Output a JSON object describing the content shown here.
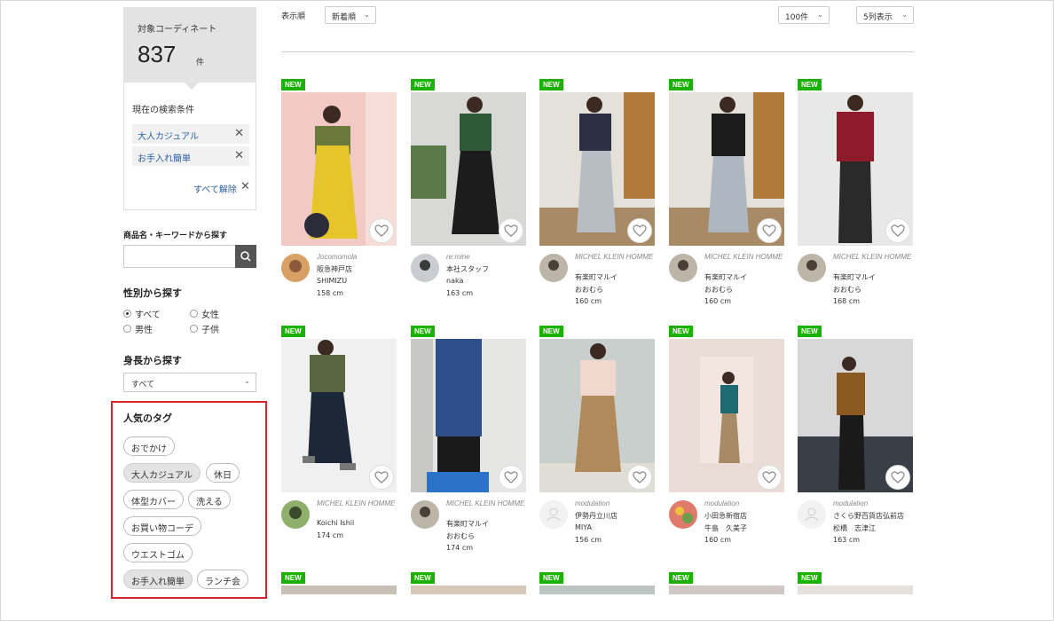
{
  "summary": {
    "label": "対象コーディネート",
    "count": "837",
    "unit": "件"
  },
  "conditions": {
    "title": "現在の検索条件",
    "items": [
      "大人カジュアル",
      "お手入れ簡単"
    ],
    "clear_all": "すべて解除"
  },
  "keyword": {
    "title": "商品名・キーワードから探す",
    "placeholder": ""
  },
  "gender": {
    "title": "性別から探す",
    "options": [
      "すべて",
      "女性",
      "男性",
      "子供"
    ],
    "selected": "すべて"
  },
  "height": {
    "title": "身長から探す",
    "value": "すべて"
  },
  "tags": {
    "title": "人気のタグ",
    "items": [
      "おでかけ",
      "大人カジュアル",
      "休日",
      "体型カバー",
      "洗える",
      "お買い物コーデ",
      "ウエストゴム",
      "お手入れ簡単",
      "ランチ会"
    ],
    "selected": [
      "大人カジュアル",
      "お手入れ簡単"
    ]
  },
  "toolbar": {
    "sort_label": "表示順",
    "sort_value": "新着順",
    "per_page": "100件",
    "columns": "5列表示"
  },
  "badge_text": "NEW",
  "cards": [
    {
      "brand": "Jocomomola",
      "store": "阪急神戸店",
      "staff": "SHIMIZU",
      "height": "158 cm"
    },
    {
      "brand": "re:mine",
      "store": "本社スタッフ",
      "staff": "naka",
      "height": "163 cm"
    },
    {
      "brand": "MICHEL KLEIN HOMME",
      "store": "有楽町マルイ",
      "staff": "おおむら",
      "height": "160 cm"
    },
    {
      "brand": "MICHEL KLEIN HOMME",
      "store": "有楽町マルイ",
      "staff": "おおむら",
      "height": "160 cm"
    },
    {
      "brand": "MICHEL KLEIN HOMME",
      "store": "有楽町マルイ",
      "staff": "おおむら",
      "height": "168 cm"
    },
    {
      "brand": "MICHEL KLEIN HOMME",
      "store": "Koichi Ishii",
      "staff": "",
      "height": "174 cm"
    },
    {
      "brand": "MICHEL KLEIN HOMME",
      "store": "有楽町マルイ",
      "staff": "おおむら",
      "height": "174 cm"
    },
    {
      "brand": "modulation",
      "store": "伊勢丹立川店",
      "staff": "MIYA",
      "height": "156 cm"
    },
    {
      "brand": "modulation",
      "store": "小田急新宿店",
      "staff": "牛島　久美子",
      "height": "160 cm"
    },
    {
      "brand": "modulation",
      "store": "さくら野百貨店弘前店",
      "staff": "松橋　志津江",
      "height": "163 cm"
    }
  ],
  "colors": {
    "badge": "#1ab100",
    "link": "#2b5fa0",
    "highlight_border": "#d9232d"
  }
}
